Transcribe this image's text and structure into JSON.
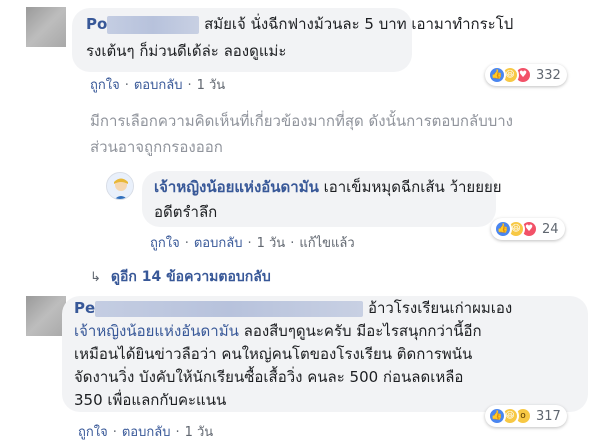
{
  "comments": [
    {
      "name": "Po",
      "line1": "สมัยเจ้ นั่งฉีกฟางม้วนละ 5 บาท เอามาทำกระโป",
      "line2": "รงเต้นๆ ก็ม่วนดีเด้ล่ะ ลองดูแม่ะ",
      "actions": {
        "like": "ถูกใจ",
        "reply": "ตอบกลับ",
        "time": "1 วัน"
      },
      "reactions": {
        "icons": [
          "like-icon",
          "haha-icon",
          "love-icon"
        ],
        "count": "332"
      }
    },
    {
      "name": "Pe",
      "mention": "เจ้าหญิงน้อยแห่งอันดามัน",
      "line1_suffix": "อ้าวโรงเรียนเก่าผมเอง",
      "line2_suffix": "ลองสืบๆดูนะครับ มีอะไรสนุกกว่านี้อีก",
      "line3": "เหมือนได้ยินข่าวลือว่า คนใหญ่คนโตของโรงเรียน ติดการพนัน",
      "line4": "จัดงานวิ่ง บังคับให้นักเรียนซื้อเสื้อวิ่ง คนละ 500 ก่อนลดเหลือ",
      "line5": "350 เพื่อแลกกับคะแนน",
      "actions": {
        "like": "ถูกใจ",
        "reply": "ตอบกลับ",
        "time": "1 วัน"
      },
      "reactions": {
        "icons": [
          "like-icon",
          "haha-icon",
          "wow-icon"
        ],
        "count": "317"
      }
    }
  ],
  "filter_note": {
    "line1": "มีการเลือกความคิดเห็นที่เกี่ยวข้องมากที่สุด ดังนั้นการตอบกลับบาง",
    "line2": "ส่วนอาจถูกกรองออก"
  },
  "reply": {
    "name": "เจ้าหญิงน้อยแห่งอันดามัน",
    "line1": "เอาเข็มหมุดฉีกเส้น ว้ายยยย",
    "line2": "อดีตรำลึก",
    "actions": {
      "like": "ถูกใจ",
      "reply": "ตอบกลับ",
      "time": "1 วัน",
      "edited": "แก้ไขแล้ว"
    },
    "reactions": {
      "icons": [
        "like-icon",
        "haha-icon",
        "love-icon"
      ],
      "count": "24"
    }
  },
  "view_more": {
    "label": "ดูอีก 14 ข้อความตอบกลับ"
  },
  "colors": {
    "link": "#385898",
    "muted": "#90949c",
    "bubble": "#f2f3f5"
  }
}
